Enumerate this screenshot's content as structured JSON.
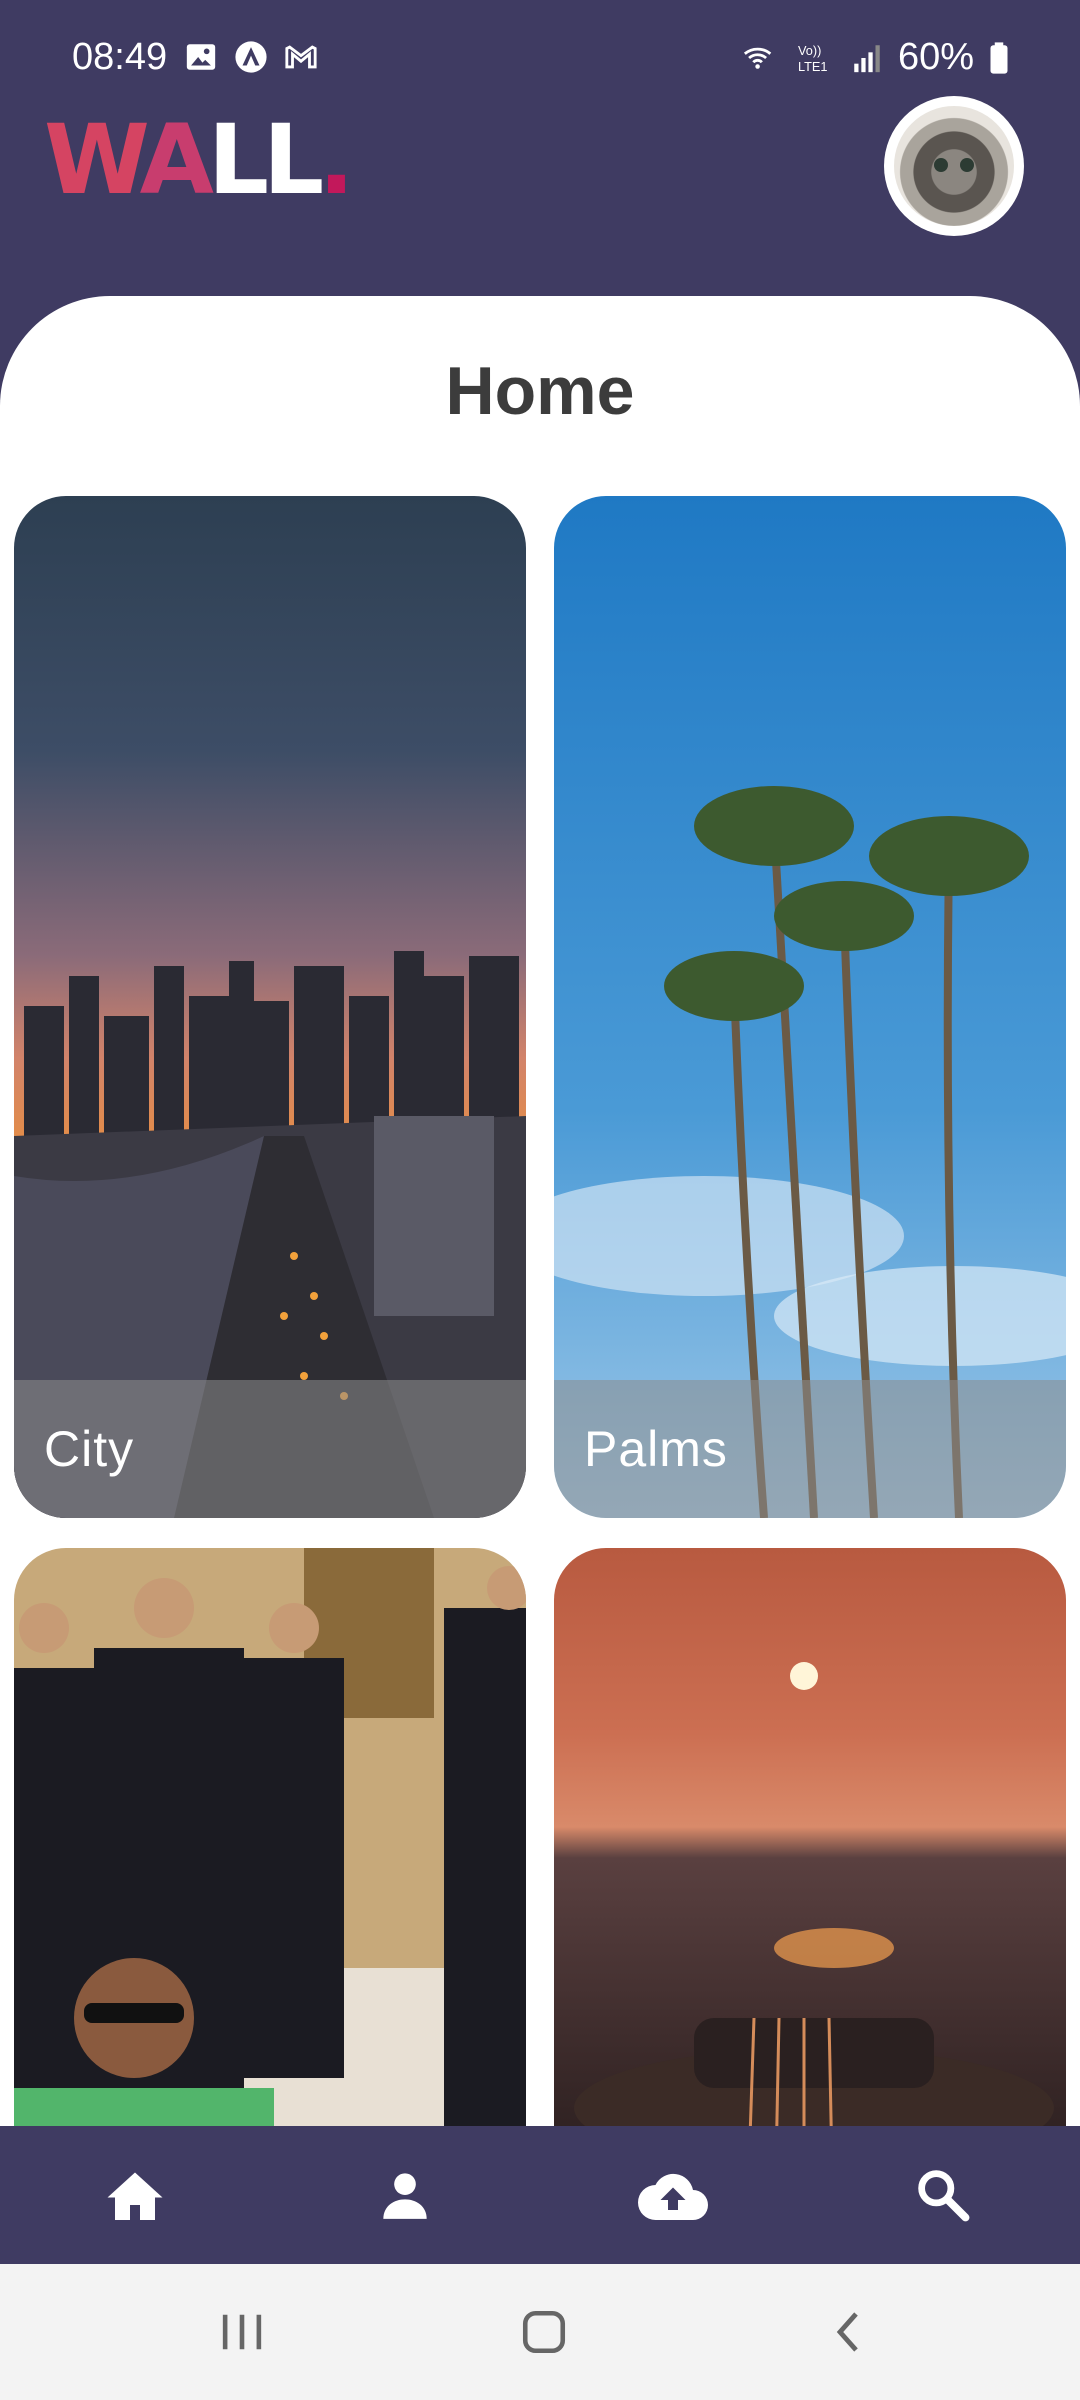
{
  "status_bar": {
    "time": "08:49",
    "battery": "60%",
    "icons": [
      "gallery-icon",
      "app-icon",
      "gmail-icon",
      "wifi-calling-icon",
      "volte-icon",
      "signal-icon",
      "battery-icon"
    ]
  },
  "header": {
    "logo_parts": [
      "W",
      "A",
      "LL",
      "."
    ],
    "avatar": "avatar"
  },
  "main": {
    "title": "Home",
    "cards": [
      {
        "caption": "City"
      },
      {
        "caption": "Palms"
      },
      {
        "caption": ""
      },
      {
        "caption": ""
      }
    ]
  },
  "bottom_nav": {
    "items": [
      "home-icon",
      "profile-icon",
      "upload-icon",
      "search-icon"
    ]
  },
  "system_nav": {
    "items": [
      "recents-icon",
      "home-button-icon",
      "back-icon"
    ]
  },
  "colors": {
    "brand": "#3f3b62",
    "accent": "#d54462",
    "sheet": "#ffffff"
  }
}
